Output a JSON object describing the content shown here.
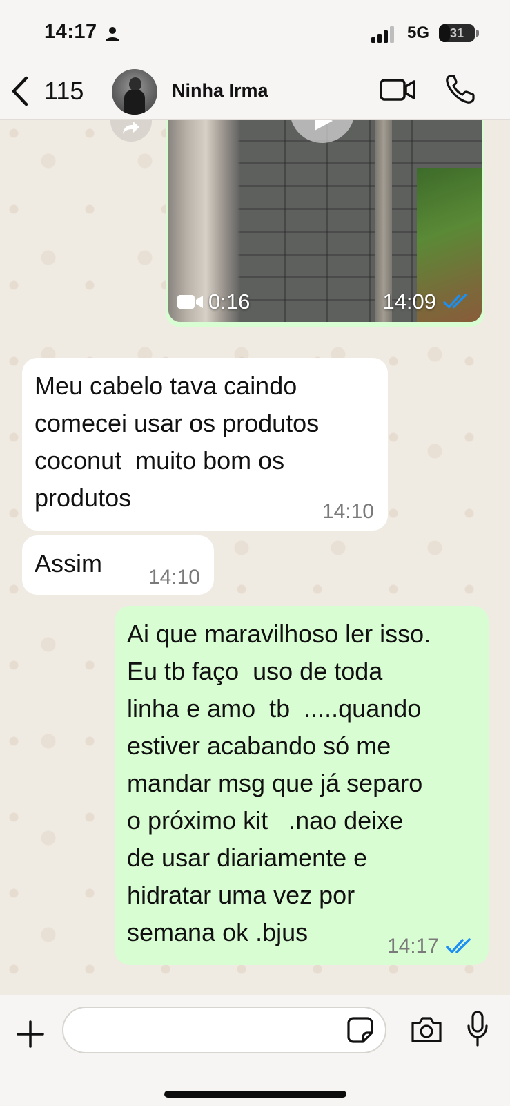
{
  "status_bar": {
    "time": "14:17",
    "network": "5G",
    "battery": "31",
    "battery_level": 0.31,
    "icons": [
      "person-icon",
      "signal-icon",
      "battery-icon"
    ]
  },
  "header": {
    "back_count": "115",
    "contact_name": "Ninha Irma",
    "icons": [
      "chevron-left-icon",
      "video-camera-icon",
      "phone-icon"
    ]
  },
  "video_message": {
    "duration": "0:16",
    "time": "14:09",
    "status": "read",
    "icons": [
      "forward-icon",
      "play-icon",
      "video-camera-icon",
      "double-check-icon"
    ]
  },
  "messages": [
    {
      "direction": "in",
      "text": "Meu cabelo tava caindo\ncomecei usar os produtos\ncoconut  muito bom os\nprodutos",
      "time": "14:10"
    },
    {
      "direction": "in",
      "text": "Assim",
      "time": "14:10"
    },
    {
      "direction": "out",
      "text": "Ai que maravilhoso ler isso.\nEu tb faço  uso de toda\nlinha e amo  tb  .....quando\nestiver acabando só me\nmandar msg que já separo\no próximo kit   .nao deixe\nde usar diariamente e\nhidratar uma vez por\nsemana ok .bjus",
      "time": "14:17",
      "status": "read"
    }
  ],
  "input_bar": {
    "placeholder": "",
    "icons": [
      "plus-icon",
      "sticker-icon",
      "camera-icon",
      "microphone-icon"
    ]
  },
  "colors": {
    "outgoing_bubble": "#d9fdd3",
    "incoming_bubble": "#ffffff",
    "chat_background": "#efeae2",
    "read_tick": "#1c8ff2"
  }
}
